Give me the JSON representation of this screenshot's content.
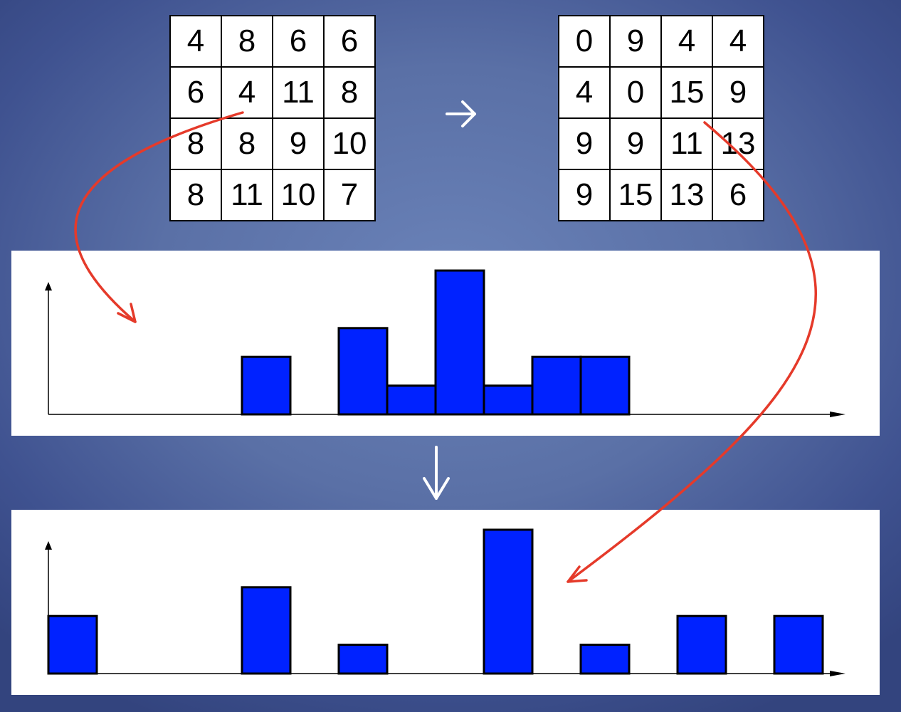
{
  "grid_before": [
    [
      "4",
      "8",
      "6",
      "6"
    ],
    [
      "6",
      "4",
      "11",
      "8"
    ],
    [
      "8",
      "8",
      "9",
      "10"
    ],
    [
      "8",
      "11",
      "10",
      "7"
    ]
  ],
  "grid_after": [
    [
      "0",
      "9",
      "4",
      "4"
    ],
    [
      "4",
      "0",
      "15",
      "9"
    ],
    [
      "9",
      "9",
      "11",
      "13"
    ],
    [
      "9",
      "15",
      "13",
      "6"
    ]
  ],
  "colors": {
    "bar_fill": "#0022ff",
    "bar_stroke": "#000000",
    "annotation_arrow": "#e53a2a",
    "flow_arrow": "#ffffff",
    "panel": "#ffffff"
  },
  "chart_data": [
    {
      "type": "bar",
      "description_role": "histogram of the left grid",
      "xlim": [
        0,
        16
      ],
      "ylim": [
        0,
        5
      ],
      "bars": [
        {
          "x": 4,
          "value": 2
        },
        {
          "x": 6,
          "value": 3
        },
        {
          "x": 7,
          "value": 1
        },
        {
          "x": 8,
          "value": 5
        },
        {
          "x": 9,
          "value": 1
        },
        {
          "x": 10,
          "value": 2
        },
        {
          "x": 11,
          "value": 2
        }
      ]
    },
    {
      "type": "bar",
      "description_role": "histogram of the right grid",
      "xlim": [
        0,
        16
      ],
      "ylim": [
        0,
        5
      ],
      "bars": [
        {
          "x": 0,
          "value": 2
        },
        {
          "x": 4,
          "value": 3
        },
        {
          "x": 6,
          "value": 1
        },
        {
          "x": 9,
          "value": 5
        },
        {
          "x": 11,
          "value": 1
        },
        {
          "x": 13,
          "value": 2
        },
        {
          "x": 15,
          "value": 2
        }
      ]
    }
  ]
}
